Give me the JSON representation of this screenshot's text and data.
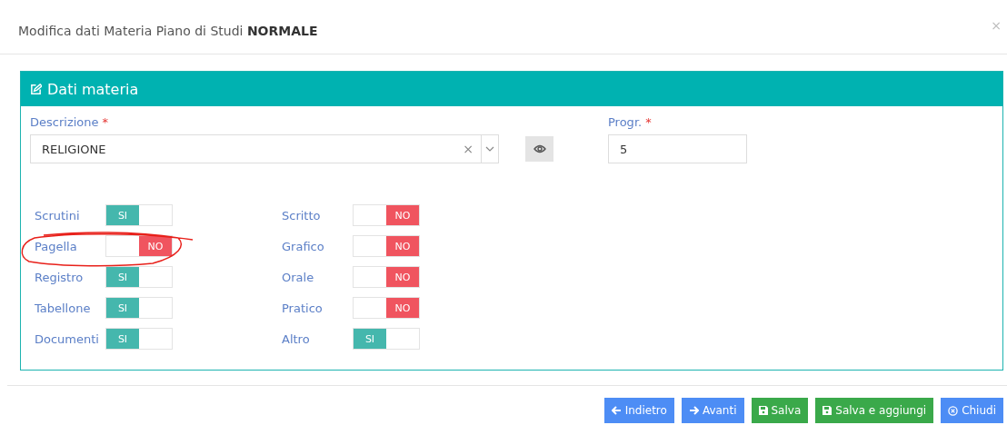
{
  "dialog": {
    "title_prefix": "Modifica dati Materia Piano di Studi",
    "title_strong": "NORMALE",
    "close": "×"
  },
  "panel": {
    "title": "Dati materia",
    "description": {
      "label": "Descrizione",
      "required": "*",
      "value": "RELIGIONE",
      "clear": "×"
    },
    "progr": {
      "label": "Progr.",
      "required": "*",
      "value": "5"
    },
    "toggles_left": [
      {
        "label": "Scrutini",
        "on": true,
        "text": "SI"
      },
      {
        "label": "Pagella",
        "on": false,
        "text": "NO"
      },
      {
        "label": "Registro",
        "on": true,
        "text": "SI"
      },
      {
        "label": "Tabellone",
        "on": true,
        "text": "SI"
      },
      {
        "label": "Documenti",
        "on": true,
        "text": "SI"
      }
    ],
    "toggles_right": [
      {
        "label": "Scritto",
        "on": false,
        "text": "NO"
      },
      {
        "label": "Grafico",
        "on": false,
        "text": "NO"
      },
      {
        "label": "Orale",
        "on": false,
        "text": "NO"
      },
      {
        "label": "Pratico",
        "on": false,
        "text": "NO"
      },
      {
        "label": "Altro",
        "on": true,
        "text": "SI"
      }
    ]
  },
  "buttons": [
    {
      "label": "Indietro",
      "kind": "back"
    },
    {
      "label": "Avanti",
      "kind": "next"
    },
    {
      "label": "Salva",
      "kind": "save"
    },
    {
      "label": "Salva e aggiungi",
      "kind": "save"
    },
    {
      "label": "Chiudi",
      "kind": "close"
    }
  ]
}
